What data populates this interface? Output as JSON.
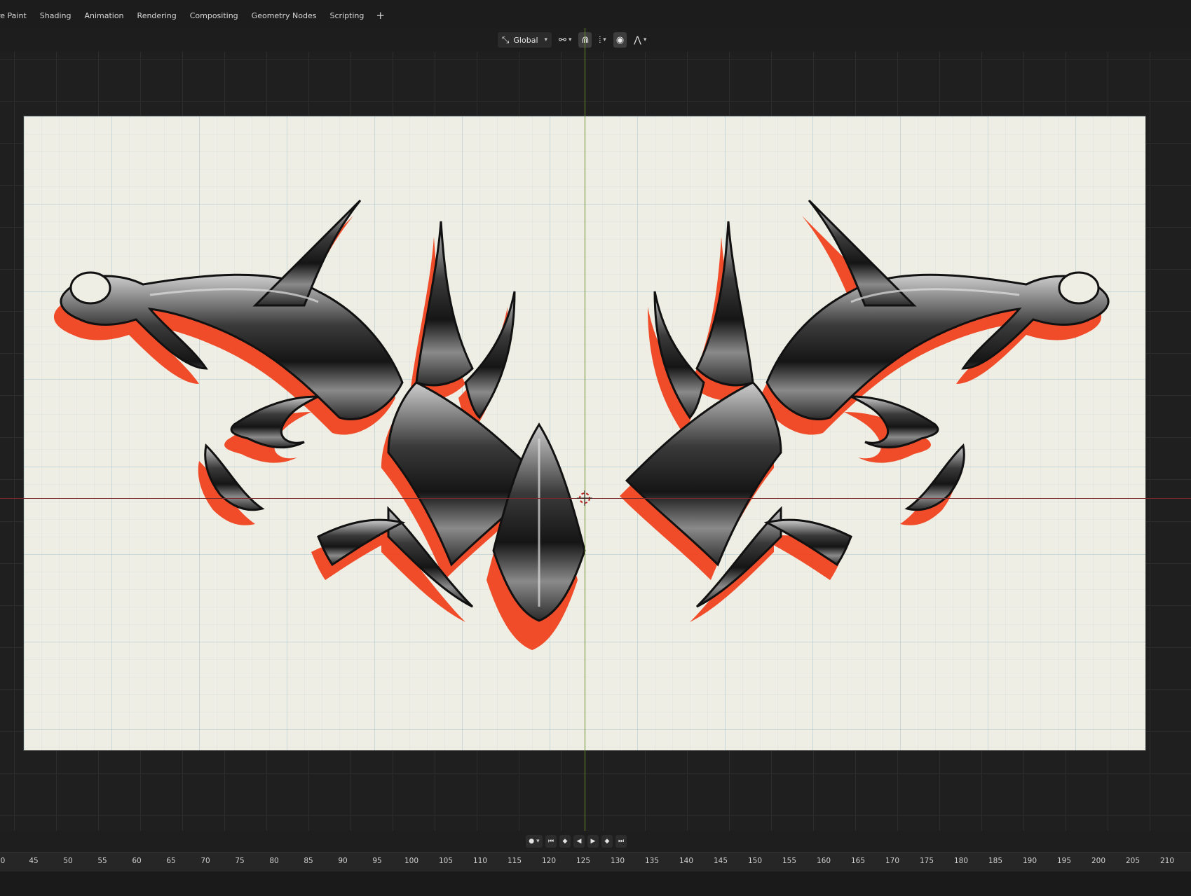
{
  "workspace_tabs": [
    "re Paint",
    "Shading",
    "Animation",
    "Rendering",
    "Compositing",
    "Geometry Nodes",
    "Scripting"
  ],
  "add_tab_label": "+",
  "header": {
    "orientation_label": "Global",
    "orientation_icon": "transform-orientation-icon",
    "pivot_icon": "link-pivot-icon",
    "snap_icon": "snap-magnet-icon",
    "snap_target_icon": "snap-increment-icon",
    "proportional_icon": "proportional-edit-icon",
    "falloff_icon": "falloff-curve-icon"
  },
  "viewport": {
    "plane_color": "#efeee4",
    "artwork_colors": {
      "chrome": "#2a2a2a",
      "highlight": "#d9d9d9",
      "shadow": "#f0431f"
    },
    "cursor_icon": "3d-cursor-icon"
  },
  "playback": {
    "record_icon": "record-icon",
    "buttons": [
      "jump-start-icon",
      "prev-keyframe-icon",
      "play-reverse-icon",
      "play-icon",
      "next-keyframe-icon",
      "jump-end-icon"
    ],
    "glyphs": [
      "⏮",
      "◆",
      "◀",
      "▶",
      "◆",
      "⏭"
    ]
  },
  "ruler_ticks": [
    "0",
    "45",
    "50",
    "55",
    "60",
    "65",
    "70",
    "75",
    "80",
    "85",
    "90",
    "95",
    "100",
    "105",
    "110",
    "115",
    "120",
    "125",
    "130",
    "135",
    "140",
    "145",
    "150",
    "155",
    "160",
    "165",
    "170",
    "175",
    "180",
    "185",
    "190",
    "195",
    "200",
    "205",
    "210"
  ]
}
